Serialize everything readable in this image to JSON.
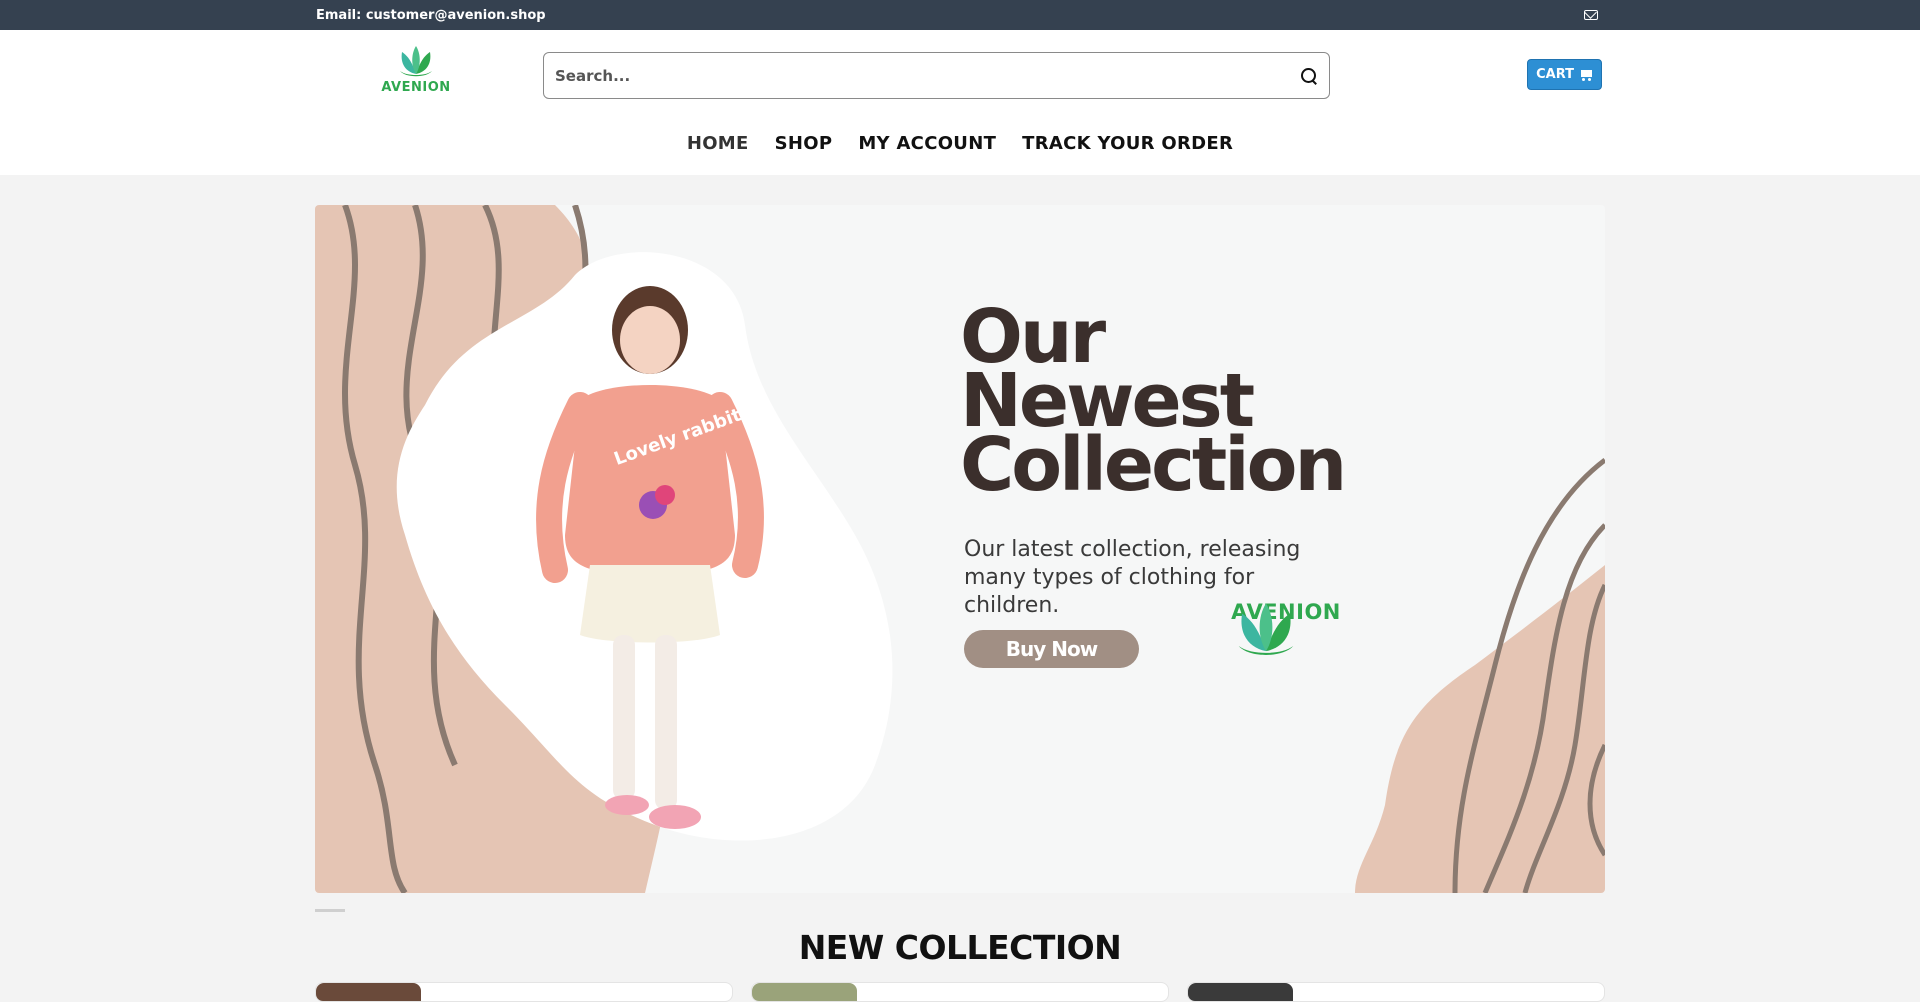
{
  "topbar": {
    "email": "Email: customer@avenion.shop",
    "mail_icon": "mail-icon"
  },
  "header": {
    "logo_text": "AVENION",
    "search_placeholder": "Search...",
    "cart_label": "CART"
  },
  "nav": {
    "items": [
      "HOME",
      "SHOP",
      "MY ACCOUNT",
      "TRACK YOUR ORDER"
    ],
    "active": "HOME"
  },
  "hero": {
    "title_line1": "Our",
    "title_line2": "Newest",
    "title_line3": "Collection",
    "subtitle": "Our latest collection, releasing many types of clothing for children.",
    "button": "Buy Now",
    "logo_text": "AVENION"
  },
  "section": {
    "title": "NEW COLLECTION"
  },
  "colors": {
    "topbar": "#354150",
    "cart": "#2d8fd4",
    "brand_green": "#2fa84f",
    "hero_beige": "#e5c5b4",
    "hero_lines": "#8a7a70"
  }
}
